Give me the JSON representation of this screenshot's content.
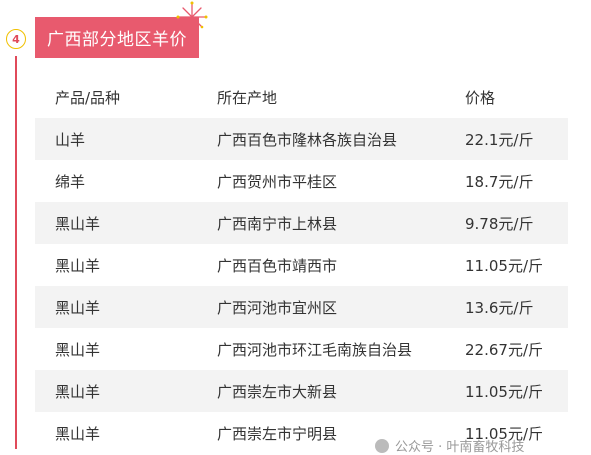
{
  "section": {
    "number": "4",
    "title": "广西部分地区羊价"
  },
  "table": {
    "headers": {
      "product": "产品/品种",
      "origin": "所在产地",
      "price": "价格"
    },
    "rows": [
      {
        "product": "山羊",
        "origin": "广西百色市隆林各族自治县",
        "price": "22.1元/斤"
      },
      {
        "product": "绵羊",
        "origin": "广西贺州市平桂区",
        "price": "18.7元/斤"
      },
      {
        "product": "黑山羊",
        "origin": "广西南宁市上林县",
        "price": "9.78元/斤"
      },
      {
        "product": "黑山羊",
        "origin": "广西百色市靖西市",
        "price": "11.05元/斤"
      },
      {
        "product": "黑山羊",
        "origin": "广西河池市宜州区",
        "price": "13.6元/斤"
      },
      {
        "product": "黑山羊",
        "origin": "广西河池市环江毛南族自治县",
        "price": "22.67元/斤"
      },
      {
        "product": "黑山羊",
        "origin": "广西崇左市大新县",
        "price": "11.05元/斤"
      },
      {
        "product": "黑山羊",
        "origin": "广西崇左市宁明县",
        "price": "11.05元/斤"
      }
    ]
  },
  "watermark": {
    "text": "公众号 · 叶南畜牧科技"
  },
  "colors": {
    "accent": "#e85a6e",
    "line": "#e04a5a",
    "stripe": "#f3f3f3"
  }
}
